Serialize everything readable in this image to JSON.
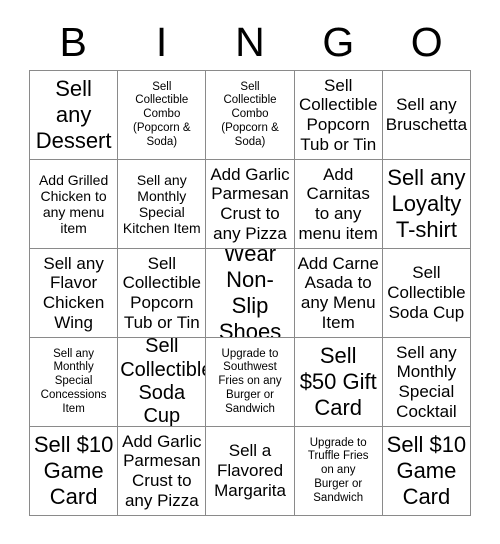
{
  "card": {
    "header": {
      "letters": [
        "B",
        "I",
        "N",
        "G",
        "O"
      ]
    },
    "rows": [
      {
        "cells": [
          {
            "text": "Sell\nany\nDessert",
            "size": "xl"
          },
          {
            "text": "Sell\nCollectible\nCombo\n(Popcorn &\nSoda)",
            "size": "xs"
          },
          {
            "text": "Sell\nCollectible\nCombo\n(Popcorn &\nSoda)",
            "size": "xs"
          },
          {
            "text": "Sell\nCollectible\nPopcorn\nTub or Tin",
            "size": "md"
          },
          {
            "text": "Sell any\nBruschetta",
            "size": "md"
          }
        ]
      },
      {
        "cells": [
          {
            "text": "Add Grilled\nChicken to\nany menu\nitem",
            "size": "sm"
          },
          {
            "text": "Sell any\nMonthly\nSpecial\nKitchen Item",
            "size": "sm"
          },
          {
            "text": "Add Garlic\nParmesan\nCrust to\nany Pizza",
            "size": "md"
          },
          {
            "text": "Add\nCarnitas\nto any\nmenu item",
            "size": "md"
          },
          {
            "text": "Sell any\nLoyalty\nT-shirt",
            "size": "xl"
          }
        ]
      },
      {
        "cells": [
          {
            "text": "Sell any\nFlavor\nChicken\nWing",
            "size": "md"
          },
          {
            "text": "Sell\nCollectible\nPopcorn\nTub or Tin",
            "size": "md"
          },
          {
            "text": "Wear\nNon-Slip\nShoes",
            "size": "xl"
          },
          {
            "text": "Add Carne\nAsada to\nany Menu\nItem",
            "size": "md"
          },
          {
            "text": "Sell\nCollectible\nSoda Cup",
            "size": "md"
          }
        ]
      },
      {
        "cells": [
          {
            "text": "Sell any\nMonthly\nSpecial\nConcessions\nItem",
            "size": "xs"
          },
          {
            "text": "Sell\nCollectible\nSoda Cup",
            "size": "lg"
          },
          {
            "text": "Upgrade to\nSouthwest\nFries on any\nBurger or\nSandwich",
            "size": "xs"
          },
          {
            "text": "Sell\n$50 Gift\nCard",
            "size": "xl"
          },
          {
            "text": "Sell any\nMonthly\nSpecial\nCocktail",
            "size": "md"
          }
        ]
      },
      {
        "cells": [
          {
            "text": "Sell $10\nGame\nCard",
            "size": "xl"
          },
          {
            "text": "Add Garlic\nParmesan\nCrust to\nany Pizza",
            "size": "md"
          },
          {
            "text": "Sell a\nFlavored\nMargarita",
            "size": "md"
          },
          {
            "text": "Upgrade to\nTruffle Fries\non any\nBurger or\nSandwich",
            "size": "xs"
          },
          {
            "text": "Sell $10\nGame\nCard",
            "size": "xl"
          }
        ]
      }
    ]
  }
}
